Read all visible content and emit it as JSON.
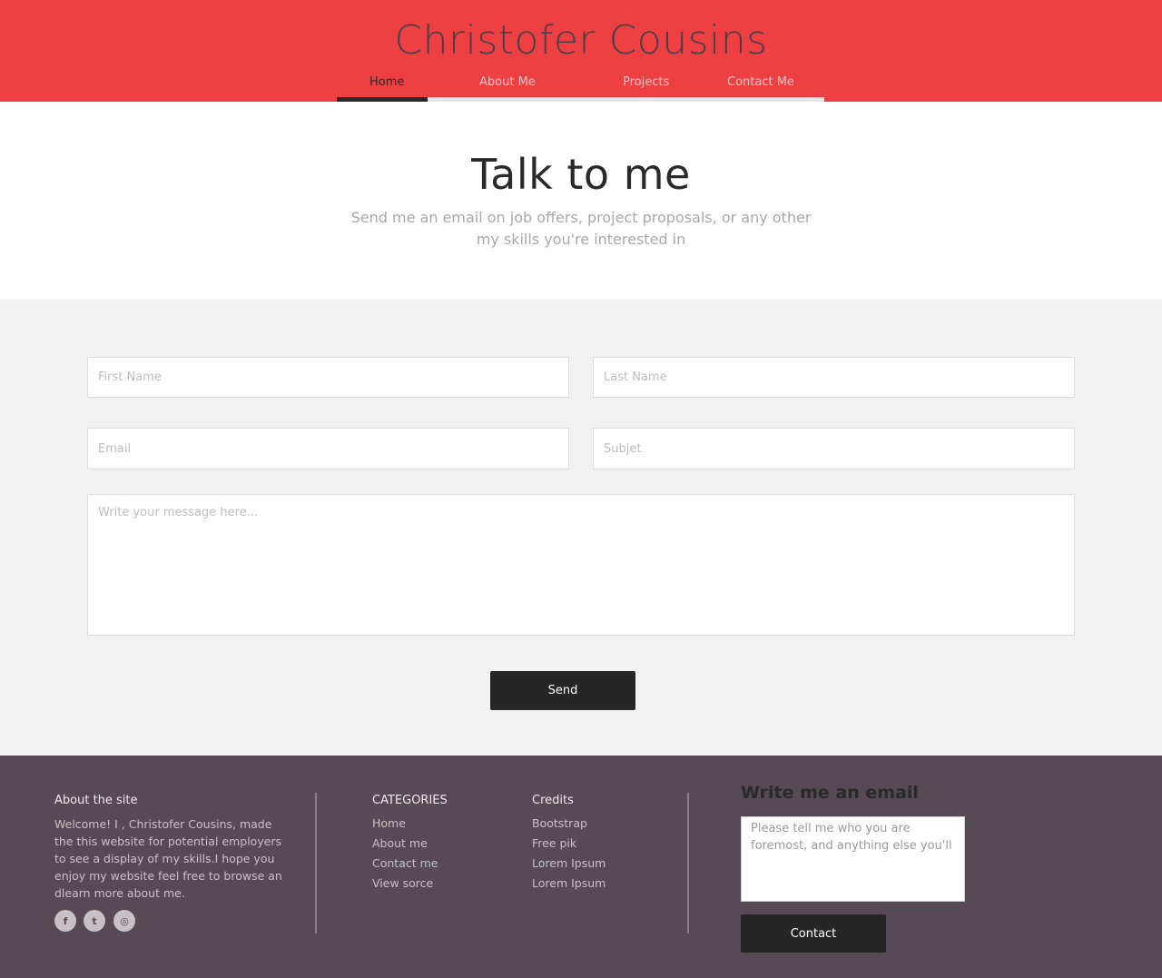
{
  "header": {
    "title": "Christofer Cousins",
    "nav": [
      {
        "label": "Home",
        "active": true
      },
      {
        "label": "About Me",
        "active": false
      },
      {
        "label": "Projects",
        "active": false
      },
      {
        "label": "Contact Me",
        "active": false
      }
    ]
  },
  "intro": {
    "heading": "Talk to me",
    "subtitle": "Send me an email on job offers, project proposals, or any other my skills you're interested in"
  },
  "form": {
    "first_name_placeholder": "First Name",
    "last_name_placeholder": "Last Name",
    "email_placeholder": "Email",
    "subject_placeholder": "Subjet",
    "message_placeholder": "Write your message here...",
    "send_label": "Send"
  },
  "footer": {
    "about": {
      "heading": "About the site",
      "text": "Welcome! I , Christofer Cousins, made the this website for potential employers to see a display of my skills.I hope you enjoy my website feel free to browse an dlearn more about me.",
      "social": [
        {
          "icon": "facebook-icon",
          "glyph": "f"
        },
        {
          "icon": "twitter-icon",
          "glyph": "t"
        },
        {
          "icon": "dribbble-icon",
          "glyph": "◎"
        }
      ]
    },
    "categories": {
      "heading": "CATEGORIES",
      "items": [
        "Home",
        "About me",
        "Contact me",
        "View sorce"
      ]
    },
    "credits": {
      "heading": "Credits",
      "items": [
        "Bootstrap",
        "Free pik",
        "Lorem Ipsum",
        "Lorem Ipsum"
      ]
    },
    "email": {
      "heading": "Write me an email",
      "placeholder": "Please tell me who you are foremost, and anything else you'll",
      "button_label": "Contact"
    }
  },
  "colors": {
    "header_bg": "#ee4043",
    "footer_bg": "#574a54",
    "form_bg": "#f1f1f1",
    "button_bg": "#262626"
  }
}
